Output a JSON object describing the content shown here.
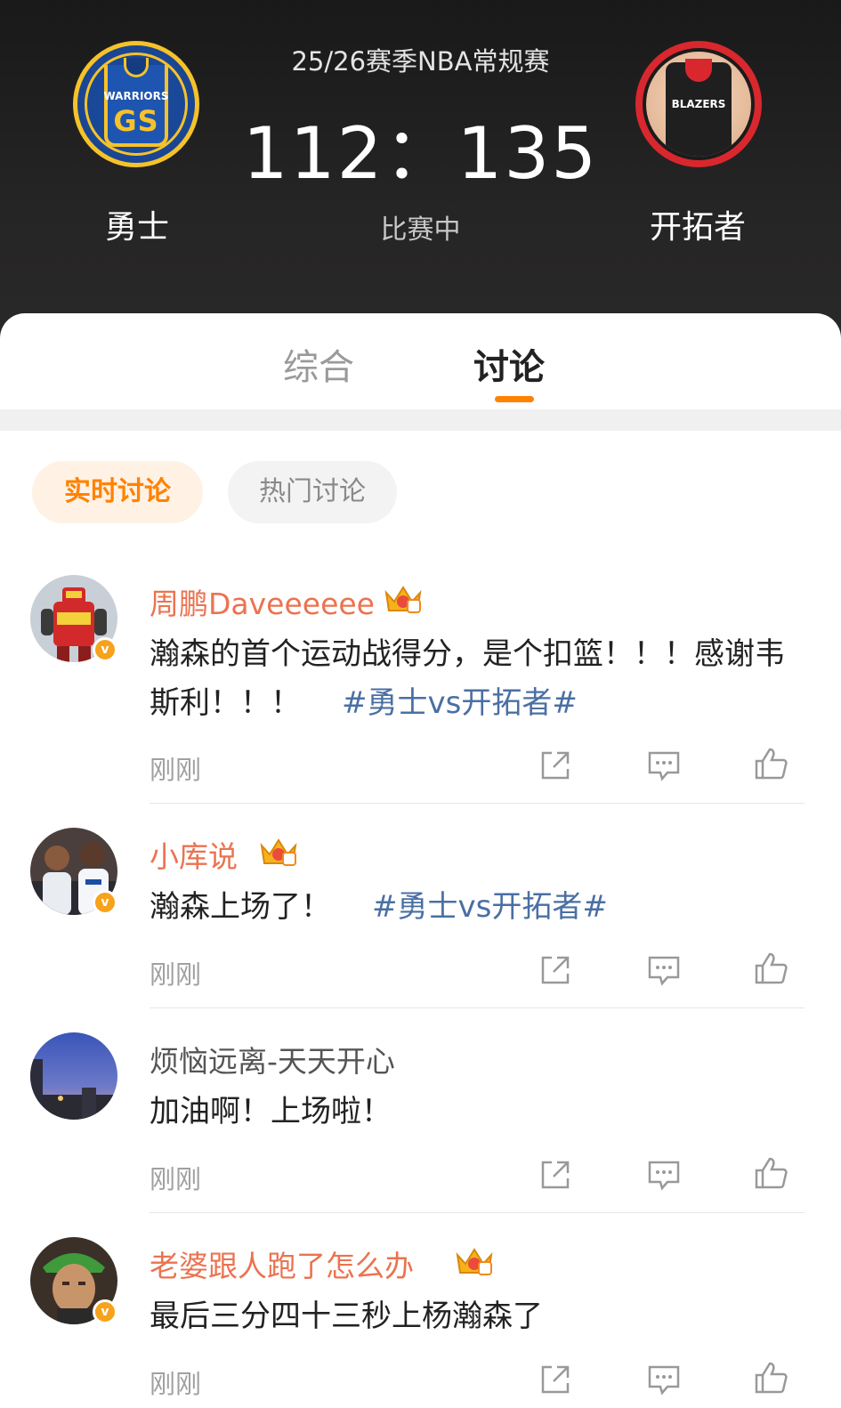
{
  "header": {
    "season": "25/26赛季NBA常规赛",
    "home_team": {
      "name": "勇士",
      "logo_word": "WARRIORS",
      "logo_letters": "GS"
    },
    "away_team": {
      "name": "开拓者",
      "logo_word": "BLAZERS"
    },
    "score": "112：135",
    "status": "比赛中"
  },
  "tabs": [
    {
      "label": "综合",
      "active": false
    },
    {
      "label": "讨论",
      "active": true
    }
  ],
  "filters": [
    {
      "label": "实时讨论",
      "active": true
    },
    {
      "label": "热门讨论",
      "active": false
    }
  ],
  "colors": {
    "accent": "#ff8200",
    "username_vip": "#eb7350",
    "hashtag": "#4a6fa3",
    "header_bg": "#1f1e1e"
  },
  "posts": [
    {
      "username": "周鹏Daveeeeee",
      "vip": true,
      "verified": true,
      "text": "瀚森的首个运动战得分，是个扣篮！！！感谢韦斯利！！！",
      "hashtag": "#勇士vs开拓者#",
      "time": "刚刚"
    },
    {
      "username": "小库说",
      "vip": true,
      "verified": true,
      "text": "瀚森上场了！",
      "hashtag": "#勇士vs开拓者#",
      "time": "刚刚"
    },
    {
      "username": "烦恼远离-天天开心",
      "vip": false,
      "verified": false,
      "text": "加油啊！上场啦！",
      "hashtag": "",
      "time": "刚刚"
    },
    {
      "username": "老婆跟人跑了怎么办",
      "vip": true,
      "verified": true,
      "text": "最后三分四十三秒上杨瀚森了",
      "hashtag": "",
      "time": "刚刚"
    }
  ],
  "icons": {
    "share": "share-icon",
    "comment": "comment-icon",
    "like": "like-icon",
    "vip_badge": "crown-icon",
    "verified_badge": "verified-icon"
  }
}
